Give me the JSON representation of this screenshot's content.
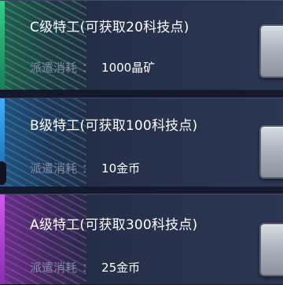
{
  "cards": [
    {
      "title": "C级特工(可获取20科技点)",
      "cost_label": "派遣消耗",
      "cost_sep": "：",
      "cost_value": "1000晶矿",
      "accent": "#2fd08a"
    },
    {
      "title": "B级特工(可获取100科技点)",
      "cost_label": "派遣消耗",
      "cost_sep": "：",
      "cost_value": "10金币",
      "accent": "#3ab2ff"
    },
    {
      "title": "A级特工(可获取300科技点)",
      "cost_label": "派遣消耗",
      "cost_sep": "：",
      "cost_value": "25金币",
      "accent": "#d05af0"
    }
  ]
}
